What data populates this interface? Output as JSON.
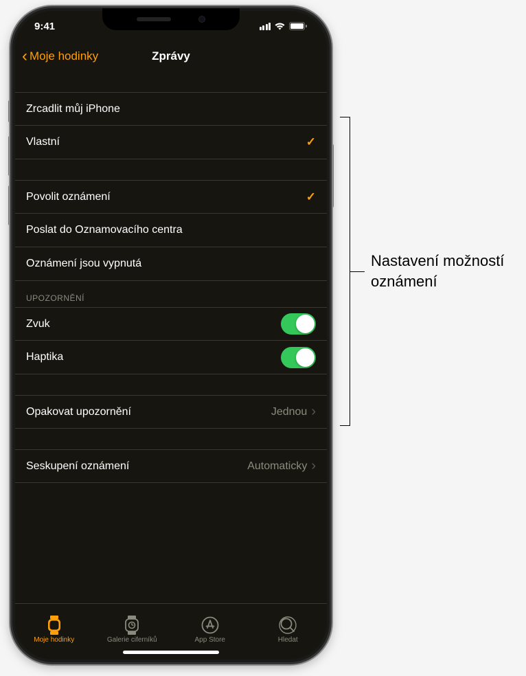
{
  "status": {
    "time": "9:41"
  },
  "nav": {
    "back_label": "Moje hodinky",
    "title": "Zprávy"
  },
  "group1": {
    "mirror": "Zrcadlit můj iPhone",
    "custom": "Vlastní"
  },
  "group2": {
    "allow": "Povolit oznámení",
    "send_center": "Poslat do Oznamovacího centra",
    "off": "Oznámení jsou vypnutá"
  },
  "alerts": {
    "header": "UPOZORNĚNÍ",
    "sound": "Zvuk",
    "haptics": "Haptika"
  },
  "repeat": {
    "label": "Opakovat upozornění",
    "value": "Jednou"
  },
  "grouping": {
    "label": "Seskupení oznámení",
    "value": "Automaticky"
  },
  "tabs": {
    "watch": "Moje hodinky",
    "gallery": "Galerie ciferníků",
    "store": "App Store",
    "search": "Hledat"
  },
  "annotation": "Nastavení možností oznámení"
}
